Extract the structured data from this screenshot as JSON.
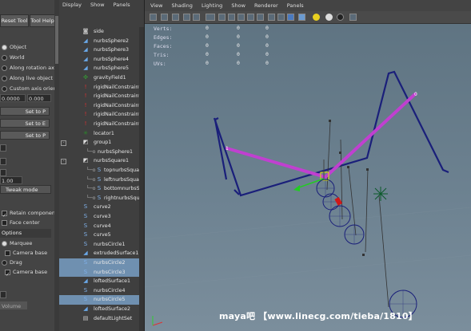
{
  "tool_panel": {
    "reset_label": "Reset Tool",
    "help_label": "Tool Help",
    "options": [
      "Object",
      "World",
      "Along rotation axi",
      "Along live object a",
      "Custom axis orien"
    ],
    "selected_option": "Object",
    "field_value": "0.0000",
    "field_value2": "0.000",
    "set_buttons": [
      "Set to P",
      "Set to E",
      "Set to P"
    ],
    "tweak_label": "Tweak mode",
    "small_field": "1.00",
    "retain_label": "Retain componen",
    "face_center_label": "Face center",
    "options_header": "Options",
    "marquee_label": "Marquee",
    "camera_based_1": "Camera base",
    "drag_label": "Drag",
    "camera_based_2": "Camera base",
    "volume_label": "Volume"
  },
  "outliner": {
    "menu": [
      "Display",
      "Show",
      "Panels"
    ],
    "items": [
      {
        "label": "side",
        "icon": "camera-icon",
        "sel": false
      },
      {
        "label": "nurbsSphere2",
        "icon": "nurbs-icon",
        "sel": false
      },
      {
        "label": "nurbsSphere3",
        "icon": "nurbs-icon",
        "sel": false
      },
      {
        "label": "nurbsSphere4",
        "icon": "nurbs-icon",
        "sel": false
      },
      {
        "label": "nurbsSphere5",
        "icon": "nurbs-icon",
        "sel": false
      },
      {
        "label": "gravityField1",
        "icon": "field-icon",
        "sel": false
      },
      {
        "label": "rigidNailConstraint",
        "icon": "constraint-icon",
        "sel": false
      },
      {
        "label": "rigidNailConstraint",
        "icon": "constraint-icon",
        "sel": false
      },
      {
        "label": "rigidNailConstraint",
        "icon": "constraint-icon",
        "sel": false
      },
      {
        "label": "rigidNailConstraint",
        "icon": "constraint-icon",
        "sel": false
      },
      {
        "label": "rigidNailConstraint",
        "icon": "constraint-icon",
        "sel": false
      },
      {
        "label": "locator1",
        "icon": "locator-icon",
        "sel": false
      },
      {
        "label": "group1",
        "icon": "group-icon",
        "sel": false,
        "expand": "-"
      },
      {
        "label": "nurbsSphere1",
        "icon": "",
        "sel": false,
        "indent": true
      },
      {
        "label": "nurbsSquare1",
        "icon": "group-icon",
        "sel": false,
        "expand": "-"
      },
      {
        "label": "topnurbsSquare",
        "icon": "curve-icon",
        "sel": false,
        "indent": true
      },
      {
        "label": "leftnurbsSquare",
        "icon": "curve-icon",
        "sel": false,
        "indent": true
      },
      {
        "label": "bottomnurbsSqu",
        "icon": "curve-icon",
        "sel": false,
        "indent": true
      },
      {
        "label": "rightnurbsSquare",
        "icon": "curve-icon",
        "sel": false,
        "indent": true
      },
      {
        "label": "curve2",
        "icon": "curve-icon",
        "sel": false
      },
      {
        "label": "curve3",
        "icon": "curve-icon",
        "sel": false
      },
      {
        "label": "curve4",
        "icon": "curve-icon",
        "sel": false
      },
      {
        "label": "curve5",
        "icon": "curve-icon",
        "sel": false
      },
      {
        "label": "nurbsCircle1",
        "icon": "curve-icon",
        "sel": false
      },
      {
        "label": "extrudedSurface1",
        "icon": "nurbs-icon",
        "sel": false
      },
      {
        "label": "nurbsCircle2",
        "icon": "curve-icon",
        "sel": true
      },
      {
        "label": "nurbsCircle3",
        "icon": "curve-icon",
        "sel": true
      },
      {
        "label": "loftedSurface1",
        "icon": "nurbs-icon",
        "sel": false
      },
      {
        "label": "nurbsCircle4",
        "icon": "curve-icon",
        "sel": false
      },
      {
        "label": "nurbsCircle5",
        "icon": "curve-icon",
        "sel": true
      },
      {
        "label": "loftedSurface2",
        "icon": "nurbs-icon",
        "sel": false
      },
      {
        "label": "defaultLightSet",
        "icon": "light-icon",
        "sel": false
      }
    ]
  },
  "viewport": {
    "menu": [
      "View",
      "Shading",
      "Lighting",
      "Show",
      "Renderer",
      "Panels"
    ],
    "hud_labels": [
      "Verts:",
      "Edges:",
      "Faces:",
      "Tris:",
      "UVs:"
    ],
    "hud_values": [
      "0",
      "0",
      "0",
      "0",
      "0"
    ],
    "watermark": "maya吧 【www.linecg.com/tieba/1810】"
  },
  "colors": {
    "outline_blue": "#1a1f7a",
    "pink": "#c040d0",
    "selection": "#6f90b0"
  }
}
